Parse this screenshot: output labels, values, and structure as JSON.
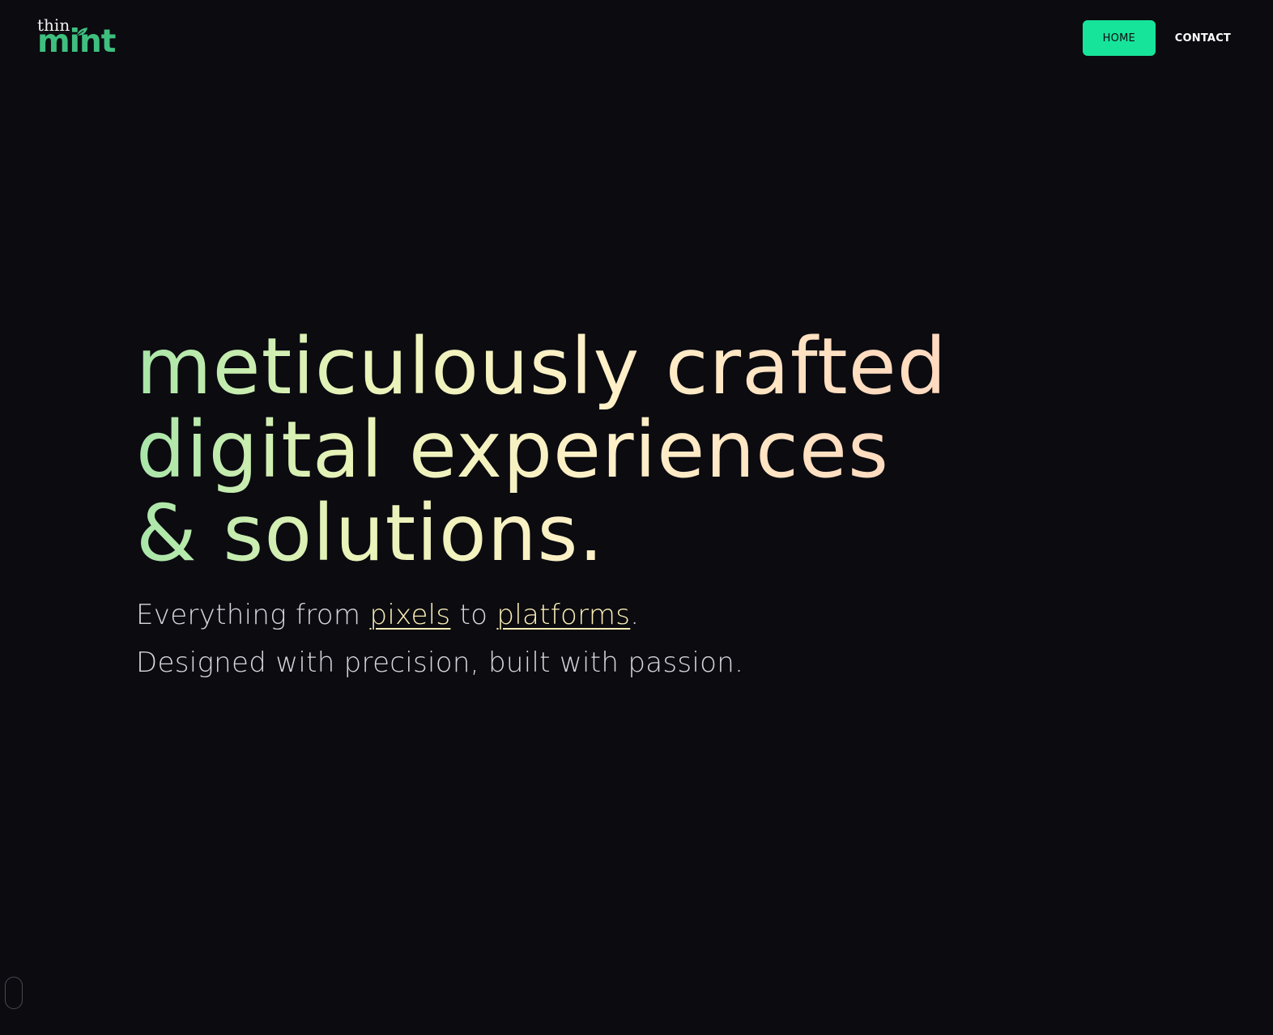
{
  "logo": {
    "top_text": "thin",
    "main_text": "mint",
    "icon": "leaf-icon",
    "primary_color": "#3fbf7f"
  },
  "nav": {
    "home_label": "HOME",
    "contact_label": "CONTACT",
    "active": "HOME",
    "accent_color": "#17e49b"
  },
  "hero": {
    "title_lines": [
      "meticulously crafted",
      "digital experiences",
      "& solutions."
    ],
    "subtitle": {
      "prefix": "Everything from ",
      "link1": "pixels",
      "middle": " to ",
      "link2": "platforms",
      "suffix": "."
    },
    "tagline": "Designed with precision, built with passion."
  },
  "colors": {
    "background": "#0b0b10",
    "link": "#fbefb7",
    "gradient_start": "#a8e6a8",
    "gradient_end": "#ffd0c0"
  },
  "scroll_indicator": {
    "icon": "mouse-scroll-icon"
  }
}
